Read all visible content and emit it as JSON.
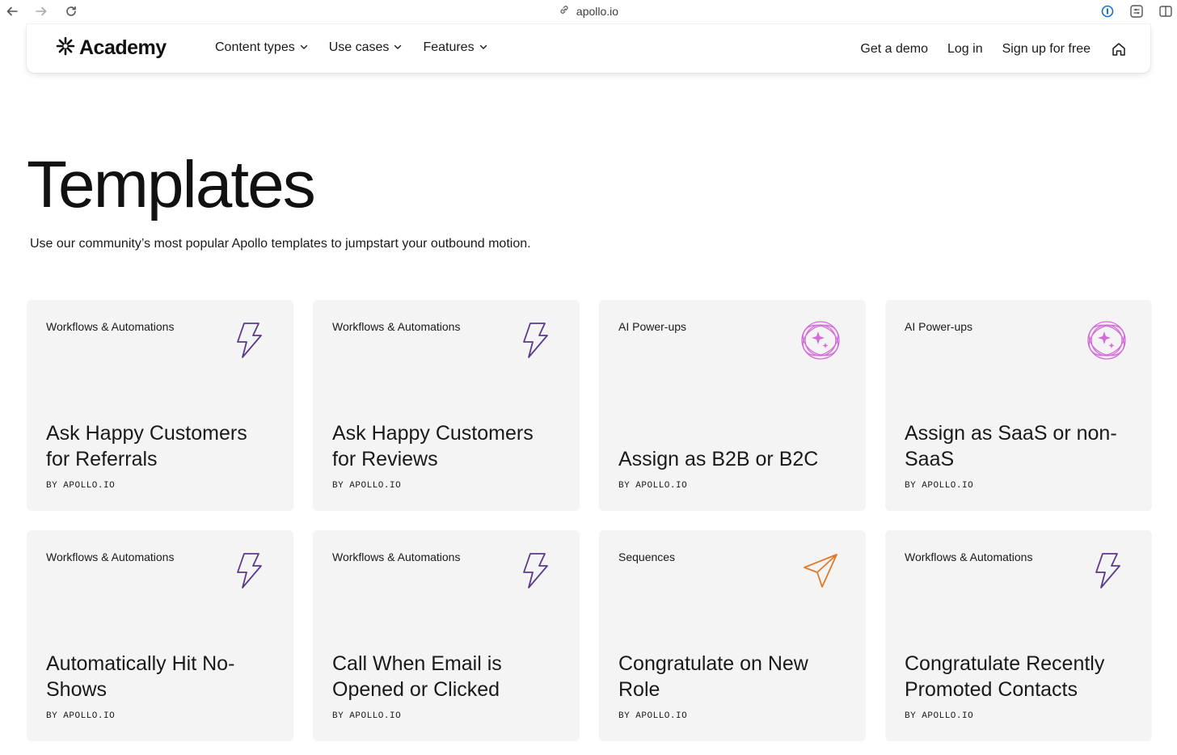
{
  "browser": {
    "url": "apollo.io"
  },
  "header": {
    "logo_text": "Academy",
    "menu": [
      {
        "label": "Content types"
      },
      {
        "label": "Use cases"
      },
      {
        "label": "Features"
      }
    ],
    "get_demo": "Get a demo",
    "login": "Log in",
    "signup": "Sign up for free"
  },
  "hero": {
    "title": "Templates",
    "subtitle": "Use our community’s most popular Apollo templates to jumpstart your outbound motion."
  },
  "cards": [
    {
      "category": "Workflows & Automations",
      "icon": "lightning-icon",
      "title": "Ask Happy Customers for Referrals",
      "author": "BY APOLLO.IO"
    },
    {
      "category": "Workflows & Automations",
      "icon": "lightning-icon",
      "title": "Ask Happy Customers for Reviews",
      "author": "BY APOLLO.IO"
    },
    {
      "category": "AI Power-ups",
      "icon": "sparkle-icon",
      "title": "Assign as B2B or B2C",
      "author": "BY APOLLO.IO"
    },
    {
      "category": "AI Power-ups",
      "icon": "sparkle-icon",
      "title": "Assign as SaaS or non-SaaS",
      "author": "BY APOLLO.IO"
    },
    {
      "category": "Workflows & Automations",
      "icon": "lightning-icon",
      "title": "Automatically Hit No-Shows",
      "author": "BY APOLLO.IO"
    },
    {
      "category": "Workflows & Automations",
      "icon": "lightning-icon",
      "title": "Call When Email is Opened or Clicked",
      "author": "BY APOLLO.IO"
    },
    {
      "category": "Sequences",
      "icon": "paper-plane-icon",
      "title": "Congratulate on New Role",
      "author": "BY APOLLO.IO"
    },
    {
      "category": "Workflows & Automations",
      "icon": "lightning-icon",
      "title": "Congratulate Recently Promoted Contacts",
      "author": "BY APOLLO.IO"
    }
  ],
  "colors": {
    "workflow_icon": "#5b3a8c",
    "ai_icon": "#d46bd9",
    "sequence_icon": "#e07a2a",
    "card_bg": "#f4f4f4"
  }
}
